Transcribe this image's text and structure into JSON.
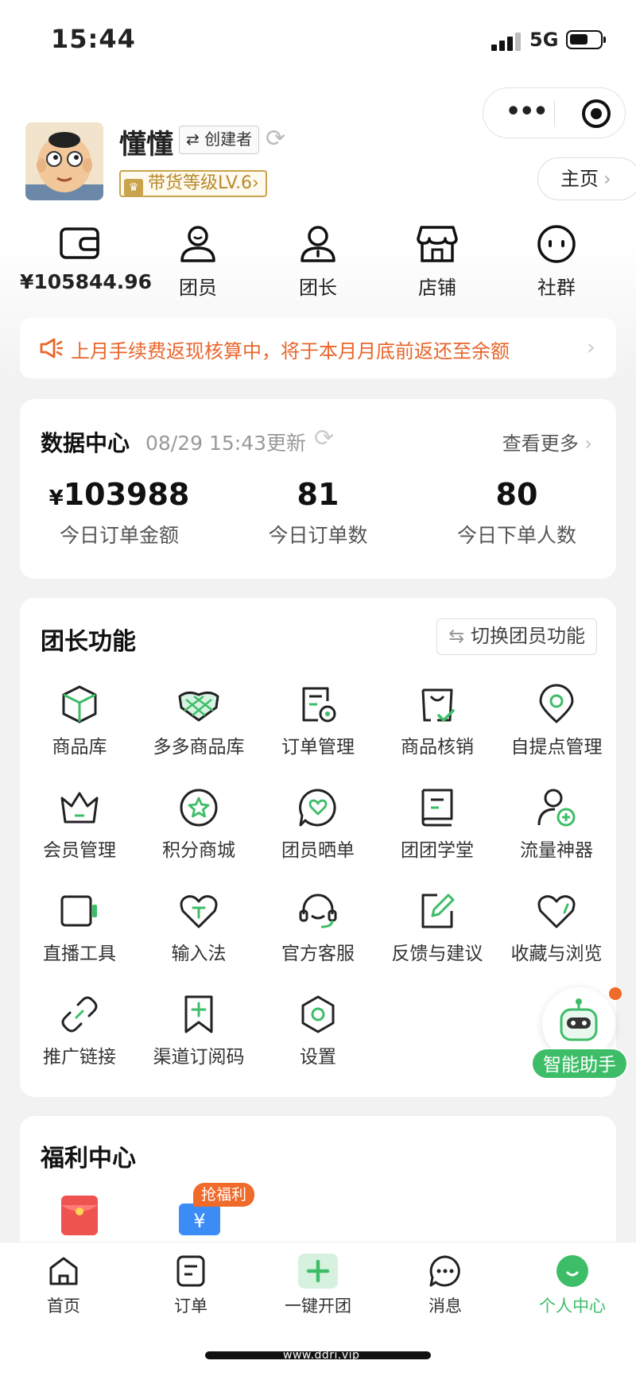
{
  "status_bar": {
    "time": "15:44",
    "network": "5G"
  },
  "profile": {
    "name": "懂懂",
    "role": "创建者",
    "level": "带货等级LV.6",
    "homepage_label": "主页"
  },
  "quick_actions": [
    {
      "label": "¥105844.96",
      "icon": "wallet-icon"
    },
    {
      "label": "团员",
      "icon": "member-icon"
    },
    {
      "label": "团长",
      "icon": "leader-icon"
    },
    {
      "label": "店铺",
      "icon": "store-icon"
    },
    {
      "label": "社群",
      "icon": "community-icon"
    }
  ],
  "notice": {
    "text": "上月手续费返现核算中，将于本月月底前返还至余额"
  },
  "data_center": {
    "title": "数据中心",
    "updated": "08/29 15:43更新",
    "more": "查看更多",
    "stats": [
      {
        "currency": "¥",
        "value": "103988",
        "label": "今日订单金额"
      },
      {
        "currency": "",
        "value": "81",
        "label": "今日订单数"
      },
      {
        "currency": "",
        "value": "80",
        "label": "今日下单人数"
      }
    ]
  },
  "leader_functions": {
    "title": "团长功能",
    "switch_label": "切换团员功能",
    "items": [
      {
        "label": "商品库",
        "icon": "cube-icon"
      },
      {
        "label": "多多商品库",
        "icon": "lattice-icon"
      },
      {
        "label": "订单管理",
        "icon": "order-manage-icon"
      },
      {
        "label": "商品核销",
        "icon": "bag-check-icon"
      },
      {
        "label": "自提点管理",
        "icon": "location-icon"
      },
      {
        "label": "会员管理",
        "icon": "crown-icon"
      },
      {
        "label": "积分商城",
        "icon": "star-circle-icon"
      },
      {
        "label": "团员晒单",
        "icon": "heart-chat-icon"
      },
      {
        "label": "团团学堂",
        "icon": "book-icon"
      },
      {
        "label": "流量神器",
        "icon": "user-add-icon"
      },
      {
        "label": "直播工具",
        "icon": "camera-icon"
      },
      {
        "label": "输入法",
        "icon": "keyboard-heart-icon"
      },
      {
        "label": "官方客服",
        "icon": "headset-icon"
      },
      {
        "label": "反馈与建议",
        "icon": "edit-icon"
      },
      {
        "label": "收藏与浏览",
        "icon": "heart-icon"
      },
      {
        "label": "推广链接",
        "icon": "link-icon"
      },
      {
        "label": "渠道订阅码",
        "icon": "bookmark-plus-icon"
      },
      {
        "label": "设置",
        "icon": "settings-icon"
      }
    ]
  },
  "assistant": {
    "label": "智能助手"
  },
  "welfare": {
    "title": "福利中心",
    "badge": "抢福利"
  },
  "tabbar": {
    "items": [
      {
        "label": "首页",
        "icon": "home-icon"
      },
      {
        "label": "订单",
        "icon": "order-icon"
      },
      {
        "label": "一键开团",
        "icon": "plus-icon"
      },
      {
        "label": "消息",
        "icon": "message-icon"
      },
      {
        "label": "个人中心",
        "icon": "profile-icon"
      }
    ],
    "active_index": 4
  },
  "watermark": "www.ddri.vip",
  "colors": {
    "accent": "#3ebd68",
    "notice": "#e8652b",
    "level": "#c9a34d"
  }
}
